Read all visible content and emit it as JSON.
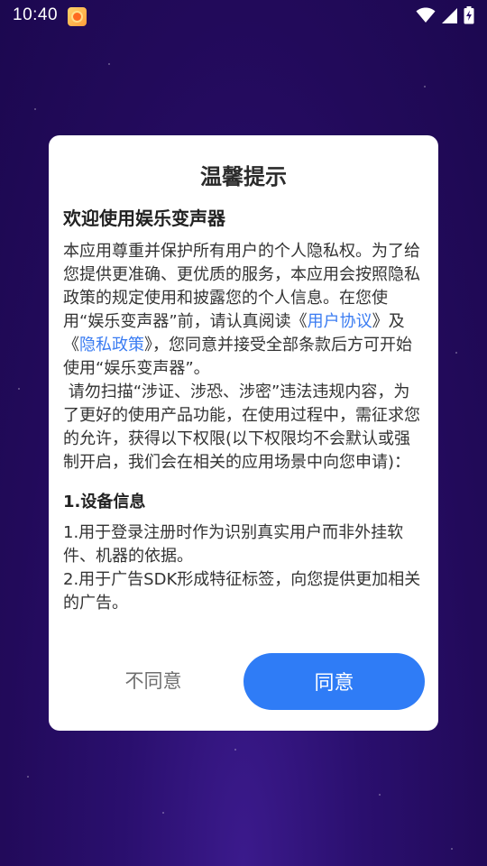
{
  "status_bar": {
    "time": "10:40",
    "app_icon": "weather-sun-icon",
    "wifi_icon": "wifi-icon",
    "signal_icon": "cellular-signal-icon",
    "battery_icon": "battery-charging-icon"
  },
  "dialog": {
    "title": "温馨提示",
    "welcome": "欢迎使用娱乐变声器",
    "intro_part1": "本应用尊重并保护所有用户的个人隐私权。为了给您提供更准确、更优质的服务，本应用会按照隐私政策的规定使用和披露您的个人信息。在您使用“娱乐变声器”前，请认真阅读《",
    "user_agreement_link": "用户协议",
    "intro_part2": "》及《",
    "privacy_policy_link": "隐私政策",
    "intro_part3": "》，您同意并接受全部条款后方可开始使用“娱乐变声器”。",
    "warning": " 请勿扫描“涉证、涉恐、涉密”违法违规内容，为了更好的使用产品功能，在使用过程中，需征求您的允许，获得以下权限(以下权限均不会默认或强制开启，我们会在相关的应用场景中向您申请)：",
    "section1_title": "1.设备信息",
    "section1_item1": "1.用于登录注册时作为识别真实用户而非外挂软件、机器的依据。",
    "section1_item2": "2.用于广告SDK形成特征标签，向您提供更加相关的广告。",
    "disagree_label": "不同意",
    "agree_label": "同意"
  },
  "colors": {
    "background": "#220a5a",
    "accent": "#2f7cf6",
    "link": "#3a7cf2"
  }
}
